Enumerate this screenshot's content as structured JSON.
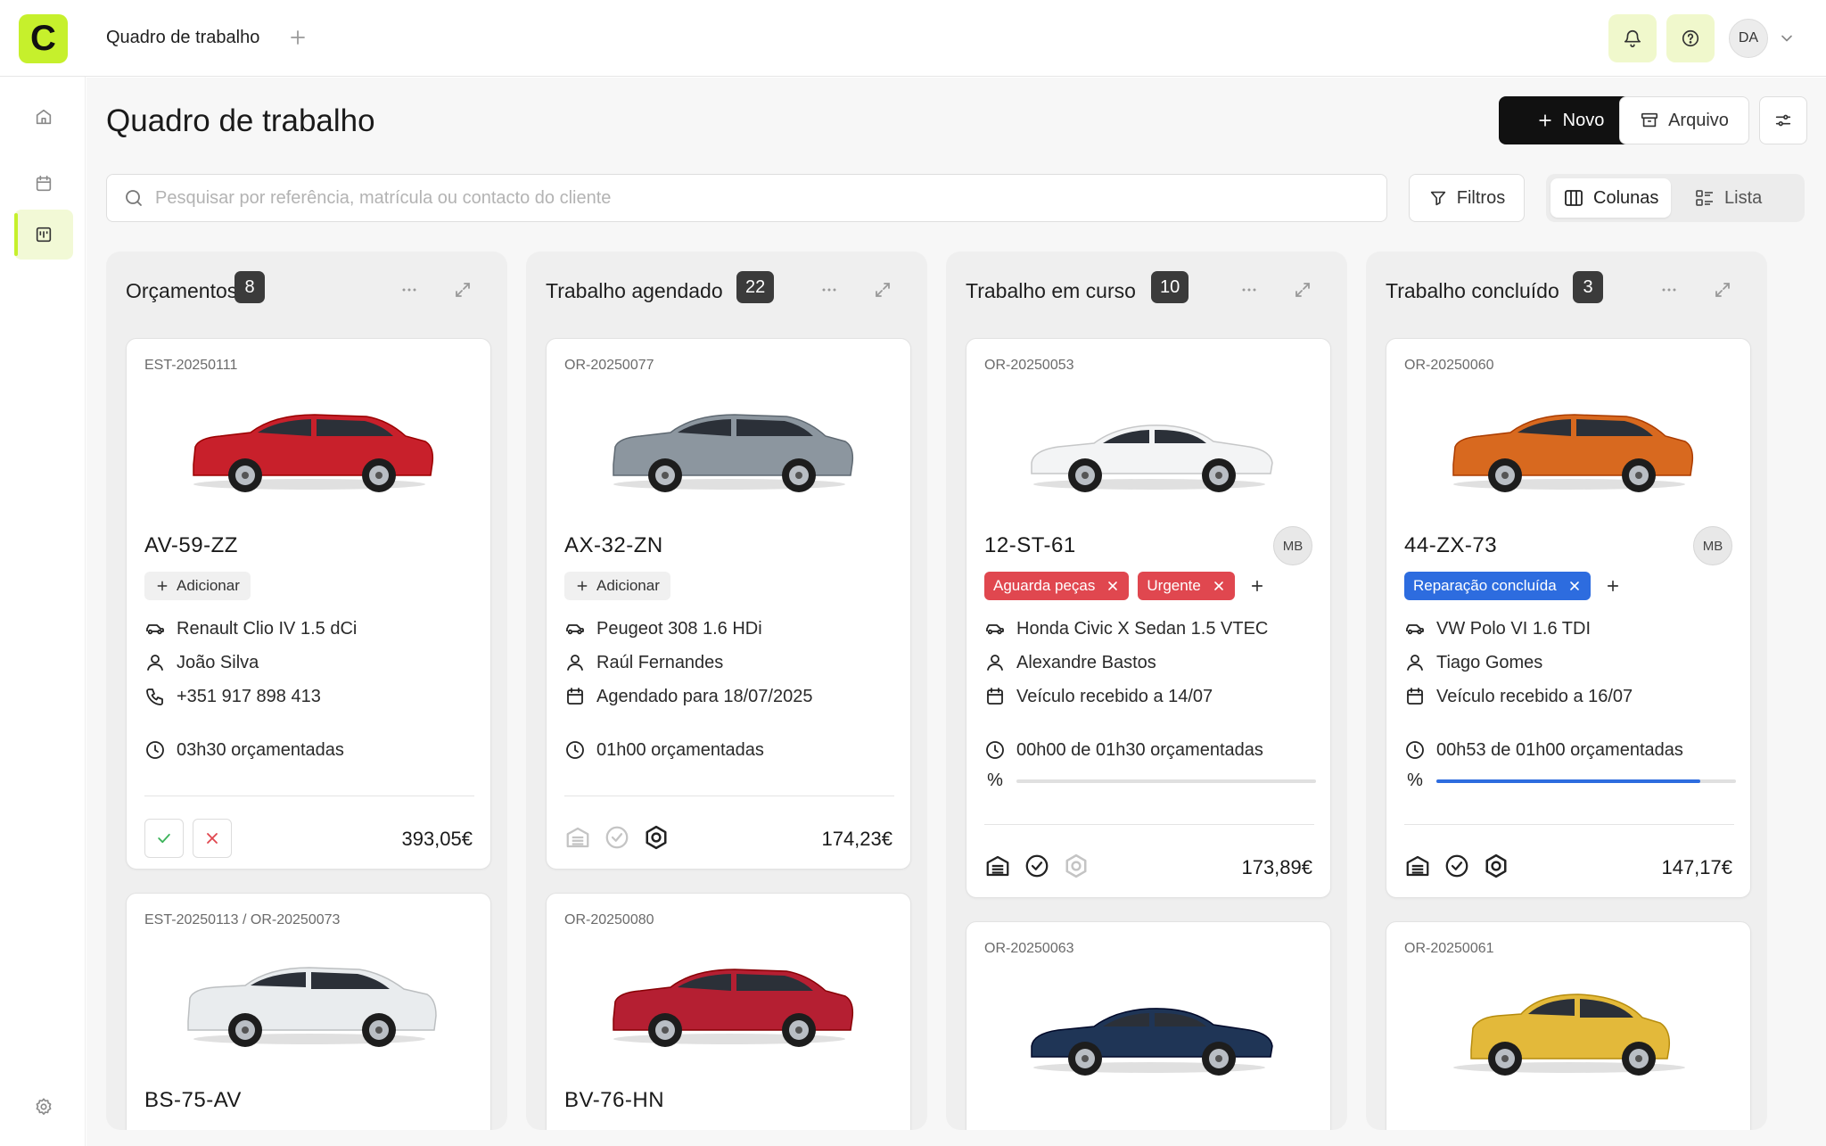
{
  "app": {
    "logo_letter": "C",
    "tab_title": "Quadro de trabalho",
    "user_initials": "DA"
  },
  "sidebar": {
    "items": [
      "home",
      "calendar",
      "board"
    ],
    "active": "board"
  },
  "page": {
    "title": "Quadro de trabalho",
    "new_label": "Novo",
    "archive_label": "Arquivo",
    "search_placeholder": "Pesquisar por referência, matrícula ou contacto do cliente",
    "filters_label": "Filtros",
    "view_columns_label": "Colunas",
    "view_list_label": "Lista",
    "active_view": "Colunas"
  },
  "columns": [
    {
      "title": "Orçamentos",
      "count": "8",
      "cards": [
        {
          "ref": "EST-20250111",
          "plate": "AV-59-ZZ",
          "add_label": "Adicionar",
          "vehicle": "Renault Clio IV 1.5 dCi",
          "customer": "João Silva",
          "third": "+351 917 898 413",
          "time": "03h30 orçamentadas",
          "price": "393,05€",
          "car_color": "#c8202b"
        },
        {
          "ref": "EST-20250113 / OR-20250073",
          "plate": "BS-75-AV",
          "car_color": "#e9ecee"
        }
      ]
    },
    {
      "title": "Trabalho agendado",
      "count": "22",
      "cards": [
        {
          "ref": "OR-20250077",
          "plate": "AX-32-ZN",
          "add_label": "Adicionar",
          "vehicle": "Peugeot 308 1.6 HDi",
          "customer": "Raúl Fernandes",
          "third": "Agendado para 18/07/2025",
          "time": "01h00 orçamentadas",
          "price": "174,23€",
          "car_color": "#8c969f"
        },
        {
          "ref": "OR-20250080",
          "plate": "BV-76-HN",
          "car_color": "#b51f32"
        }
      ]
    },
    {
      "title": "Trabalho em curso",
      "count": "10",
      "cards": [
        {
          "ref": "OR-20250053",
          "plate": "12-ST-61",
          "assignee": "MB",
          "tags": [
            {
              "label": "Aguarda peças",
              "color": "#e0474f"
            },
            {
              "label": "Urgente",
              "color": "#e0474f"
            }
          ],
          "vehicle": "Honda Civic X Sedan 1.5 VTEC",
          "customer": "Alexandre Bastos",
          "third": "Veículo recebido a 14/07",
          "time": "00h00 de 01h30 orçamentadas",
          "percent_symbol": "%",
          "progress": 0,
          "price": "173,89€",
          "car_color": "#f3f4f5"
        },
        {
          "ref": "OR-20250063",
          "car_color": "#1f3556"
        }
      ]
    },
    {
      "title": "Trabalho concluído",
      "count": "3",
      "cards": [
        {
          "ref": "OR-20250060",
          "plate": "44-ZX-73",
          "assignee": "MB",
          "tags": [
            {
              "label": "Reparação concluída",
              "color": "#2d6cdf"
            }
          ],
          "vehicle": "VW Polo VI 1.6 TDI",
          "customer": "Tiago Gomes",
          "third": "Veículo recebido a 16/07",
          "time": "00h53 de 01h00 orçamentadas",
          "percent_symbol": "%",
          "progress": 0.88,
          "price": "147,17€",
          "car_color": "#d8691f"
        },
        {
          "ref": "OR-20250061",
          "car_color": "#e3b93a"
        }
      ]
    }
  ]
}
